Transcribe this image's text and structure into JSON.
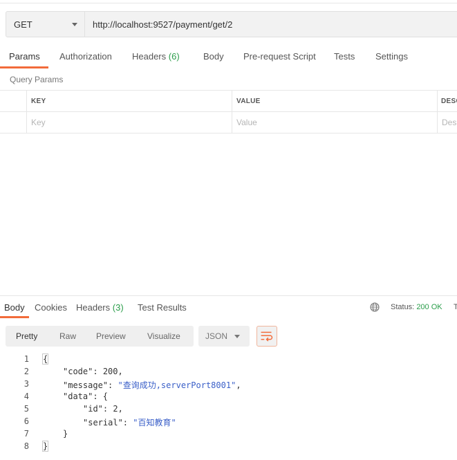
{
  "request": {
    "method": "GET",
    "url": "http://localhost:9527/payment/get/2"
  },
  "request_tabs": [
    {
      "label": "Params"
    },
    {
      "label": "Authorization"
    },
    {
      "label": "Headers",
      "count": "(6)"
    },
    {
      "label": "Body"
    },
    {
      "label": "Pre-request Script"
    },
    {
      "label": "Tests"
    },
    {
      "label": "Settings"
    }
  ],
  "query_params": {
    "title": "Query Params",
    "columns": [
      "KEY",
      "VALUE",
      "DESC"
    ],
    "placeholders": [
      "Key",
      "Value",
      "Des"
    ]
  },
  "response_tabs": [
    {
      "label": "Body"
    },
    {
      "label": "Cookies"
    },
    {
      "label": "Headers",
      "count": "(3)"
    },
    {
      "label": "Test Results"
    }
  ],
  "status": {
    "label": "Status:",
    "value": "200 OK",
    "cutoff": "T"
  },
  "view_modes": [
    "Pretty",
    "Raw",
    "Preview",
    "Visualize"
  ],
  "format": "JSON",
  "code": {
    "line_numbers": [
      "1",
      "2",
      "3",
      "4",
      "5",
      "6",
      "7",
      "8"
    ],
    "open_brace": "{",
    "code_key": "\"code\"",
    "code_val": "200",
    "message_key": "\"message\"",
    "message_val": "\"查询成功,serverPort8001\"",
    "data_key": "\"data\"",
    "id_key": "\"id\"",
    "id_val": "2",
    "serial_key": "\"serial\"",
    "serial_val": "\"百知教育\"",
    "inner_close": "}",
    "close_brace": "}"
  },
  "colors": {
    "accent": "#f26b3a",
    "status_ok": "#2a9d4a",
    "string": "#3a5fc8"
  }
}
